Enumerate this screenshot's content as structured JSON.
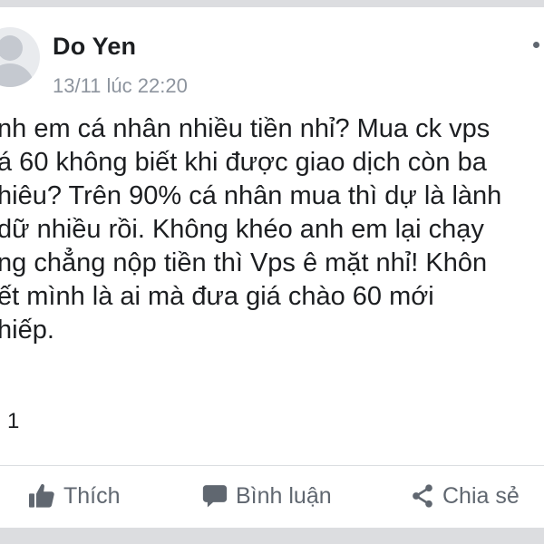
{
  "post": {
    "author": "Do Yen",
    "timestamp": "13/11 lúc 22:20",
    "lines": [
      "nh em cá nhân nhiều tiền nhỉ? Mua ck vps",
      "á 60 không biết khi được giao dịch còn ba",
      "hiêu? Trên 90% cá nhân mua thì dự là lành",
      "dữ nhiều rồi. Không khéo anh em lại chạy",
      "ng chẳng nộp tiền thì Vps ê mặt nhỉ! Khôn",
      "ết mình là ai mà đưa giá chào 60 mới",
      "hiếp."
    ],
    "reaction_count": "1"
  },
  "actions": {
    "like": "Thích",
    "comment": "Bình luận",
    "share": "Chia sẻ"
  },
  "icons": {
    "avatar": "default-avatar-icon",
    "more": "more-options-icon",
    "like": "thumbs-up-icon",
    "comment": "speech-bubble-icon",
    "share": "share-icon"
  },
  "colors": {
    "text": "#1c1e21",
    "secondary": "#8d949e",
    "action": "#606770",
    "background": "#ffffff",
    "frame": "#dcdde0"
  }
}
